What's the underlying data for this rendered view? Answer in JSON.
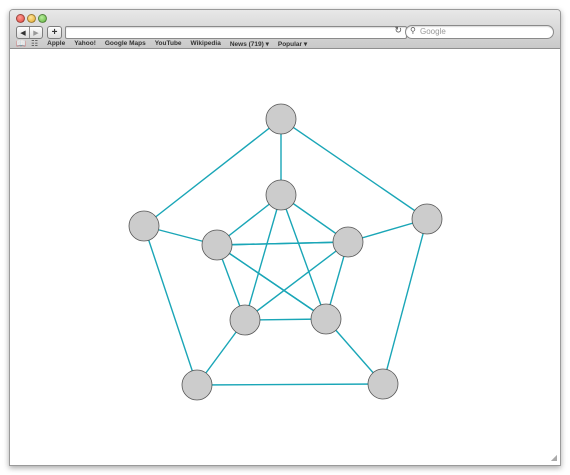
{
  "browser": {
    "back_icon": "back-arrow-icon",
    "forward_icon": "forward-arrow-icon",
    "add_tab": "+",
    "reload_icon": "reload-icon",
    "search_placeholder": "Google",
    "bookmarks": [
      "Apple",
      "Yahoo!",
      "Google Maps",
      "YouTube",
      "Wikipedia",
      "News (719) ▾",
      "Popular ▾"
    ]
  },
  "graph": {
    "edge_color": "#1aa6b7",
    "node_fill": "#cccccc",
    "node_stroke": "#555555",
    "nodes": [
      "outer-top",
      "outer-right",
      "outer-bottom-right",
      "outer-bottom-left",
      "outer-left",
      "inner-top",
      "inner-right",
      "inner-bottom-right",
      "inner-bottom-left",
      "inner-left"
    ],
    "edges": [
      [
        0,
        1
      ],
      [
        1,
        2
      ],
      [
        2,
        3
      ],
      [
        3,
        4
      ],
      [
        4,
        0
      ],
      [
        0,
        5
      ],
      [
        1,
        6
      ],
      [
        2,
        7
      ],
      [
        3,
        8
      ],
      [
        4,
        9
      ],
      [
        5,
        7
      ],
      [
        7,
        9
      ],
      [
        9,
        6
      ],
      [
        6,
        8
      ],
      [
        8,
        5
      ],
      [
        5,
        9
      ],
      [
        9,
        7
      ],
      [
        6,
        7
      ],
      [
        7,
        8
      ],
      [
        8,
        9
      ],
      [
        5,
        6
      ],
      [
        6,
        9
      ]
    ]
  }
}
